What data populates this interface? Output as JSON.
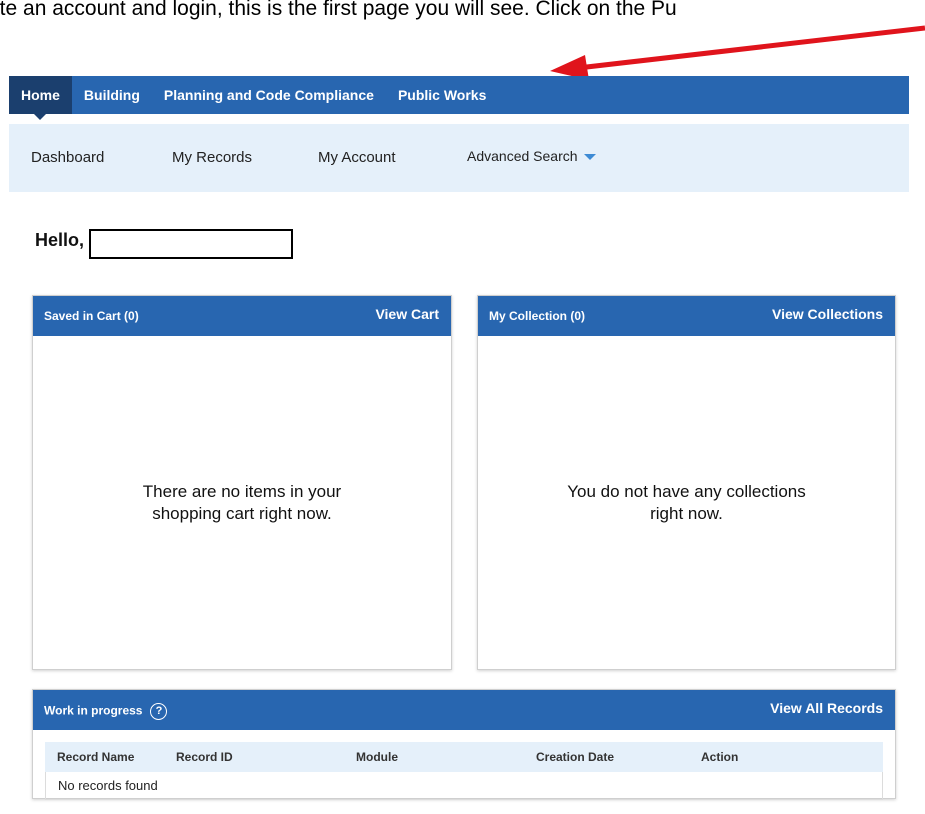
{
  "caption": "ate an account and login, this is the first page you will see. Click on the Pu",
  "colors": {
    "brand_blue": "#2866b0",
    "light_blue": "#e5f0fa",
    "arrow_red": "#e0141c"
  },
  "topnav": {
    "tabs": [
      {
        "label": "Home",
        "active": true
      },
      {
        "label": "Building",
        "active": false
      },
      {
        "label": "Planning and Code Compliance",
        "active": false
      },
      {
        "label": "Public Works",
        "active": false
      }
    ]
  },
  "subnav": {
    "dashboard": "Dashboard",
    "my_records": "My Records",
    "my_account": "My Account",
    "advanced_search": "Advanced Search"
  },
  "greeting": "Hello,",
  "cart": {
    "title": "Saved in Cart (0)",
    "link": "View Cart",
    "empty_message": "There are no items in your shopping cart right now."
  },
  "collection": {
    "title": "My Collection (0)",
    "link": "View Collections",
    "empty_message": "You do not have any collections right now."
  },
  "work_in_progress": {
    "title": "Work in progress",
    "help_glyph": "?",
    "link": "View All Records",
    "columns": [
      "Record Name",
      "Record ID",
      "Module",
      "Creation Date",
      "Action"
    ],
    "empty_message": "No records found"
  }
}
